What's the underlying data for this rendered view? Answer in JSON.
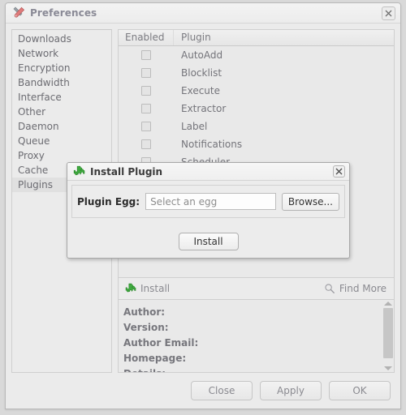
{
  "window": {
    "title": "Preferences",
    "title_icon": "tools-icon",
    "close_icon": "close-icon"
  },
  "sidebar": {
    "items": [
      {
        "label": "Downloads",
        "selected": false
      },
      {
        "label": "Network",
        "selected": false
      },
      {
        "label": "Encryption",
        "selected": false
      },
      {
        "label": "Bandwidth",
        "selected": false
      },
      {
        "label": "Interface",
        "selected": false
      },
      {
        "label": "Other",
        "selected": false
      },
      {
        "label": "Daemon",
        "selected": false
      },
      {
        "label": "Queue",
        "selected": false
      },
      {
        "label": "Proxy",
        "selected": false
      },
      {
        "label": "Cache",
        "selected": false
      },
      {
        "label": "Plugins",
        "selected": true
      }
    ]
  },
  "plugin_table": {
    "columns": [
      "Enabled",
      "Plugin"
    ],
    "rows": [
      {
        "enabled": false,
        "name": "AutoAdd"
      },
      {
        "enabled": false,
        "name": "Blocklist"
      },
      {
        "enabled": false,
        "name": "Execute"
      },
      {
        "enabled": false,
        "name": "Extractor"
      },
      {
        "enabled": false,
        "name": "Label"
      },
      {
        "enabled": false,
        "name": "Notifications"
      },
      {
        "enabled": false,
        "name": "Scheduler"
      }
    ]
  },
  "plugin_toolbar": {
    "install_label": "Install",
    "install_icon": "puzzle-piece-icon",
    "find_more_label": "Find More",
    "find_more_icon": "magnifier-icon"
  },
  "detail_panel": {
    "fields": [
      {
        "label": "Author:"
      },
      {
        "label": "Version:"
      },
      {
        "label": "Author Email:"
      },
      {
        "label": "Homepage:"
      },
      {
        "label": "Details:"
      }
    ],
    "scrollbar": {
      "up_icon": "triangle-up-icon",
      "down_icon": "triangle-down-icon"
    }
  },
  "footer": {
    "buttons": [
      {
        "label": "Close"
      },
      {
        "label": "Apply"
      },
      {
        "label": "OK"
      }
    ]
  },
  "modal": {
    "title": "Install Plugin",
    "title_icon": "puzzle-piece-icon",
    "close_icon": "close-icon",
    "field_label": "Plugin Egg:",
    "input_value": "",
    "input_placeholder": "Select an egg",
    "browse_label": "Browse...",
    "install_label": "Install"
  },
  "colors": {
    "window_bg": "#ebebeb",
    "panel_bg": "#e9e9e9",
    "border": "#cfcfcf",
    "text": "#74747a",
    "title_text": "#8a8a96",
    "accent_green": "#3faa3f",
    "selected_row": "#e0e0e0"
  }
}
